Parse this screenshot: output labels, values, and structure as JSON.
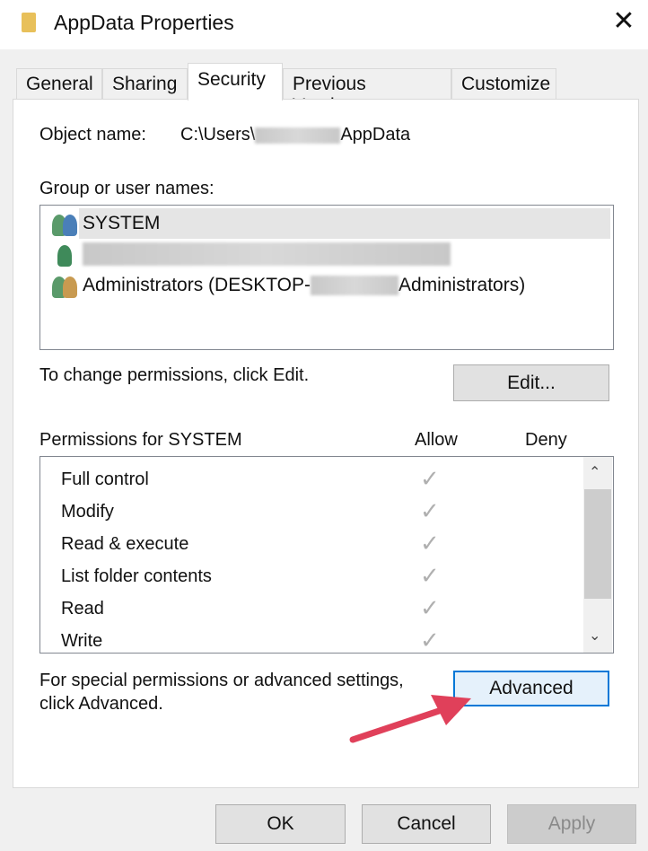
{
  "window": {
    "title": "AppData Properties",
    "close_icon": "close-icon",
    "folder_icon": "folder-icon"
  },
  "tabs": [
    {
      "label": "General"
    },
    {
      "label": "Sharing"
    },
    {
      "label": "Security",
      "active": true
    },
    {
      "label": "Previous Versions"
    },
    {
      "label": "Customize"
    }
  ],
  "security": {
    "object_label": "Object name:",
    "object_prefix": "C:\\Users\\",
    "object_suffix": "AppData",
    "group_label": "Group or user names:",
    "users": [
      {
        "name": "SYSTEM",
        "icon": "group-users-icon",
        "selected": true
      },
      {
        "name": "",
        "icon": "user-icon",
        "redacted": true
      },
      {
        "name_prefix": "Administrators (DESKTOP-",
        "name_suffix": "Administrators)",
        "icon": "group-users-icon"
      }
    ],
    "change_text": "To change permissions, click Edit.",
    "edit_button": "Edit...",
    "permissions_label": "Permissions for SYSTEM",
    "allow_header": "Allow",
    "deny_header": "Deny",
    "permissions": [
      {
        "name": "Full control",
        "allow": true,
        "deny": false
      },
      {
        "name": "Modify",
        "allow": true,
        "deny": false
      },
      {
        "name": "Read & execute",
        "allow": true,
        "deny": false
      },
      {
        "name": "List folder contents",
        "allow": true,
        "deny": false
      },
      {
        "name": "Read",
        "allow": true,
        "deny": false
      },
      {
        "name": "Write",
        "allow": true,
        "deny": false
      }
    ],
    "advanced_text_1": "For special permissions or advanced settings,",
    "advanced_text_2": "click Advanced.",
    "advanced_button": "Advanced"
  },
  "footer": {
    "ok": "OK",
    "cancel": "Cancel",
    "apply": "Apply"
  },
  "colors": {
    "focus": "#0078d7",
    "arrow": "#e0405a",
    "selection": "#e5e5e5"
  }
}
